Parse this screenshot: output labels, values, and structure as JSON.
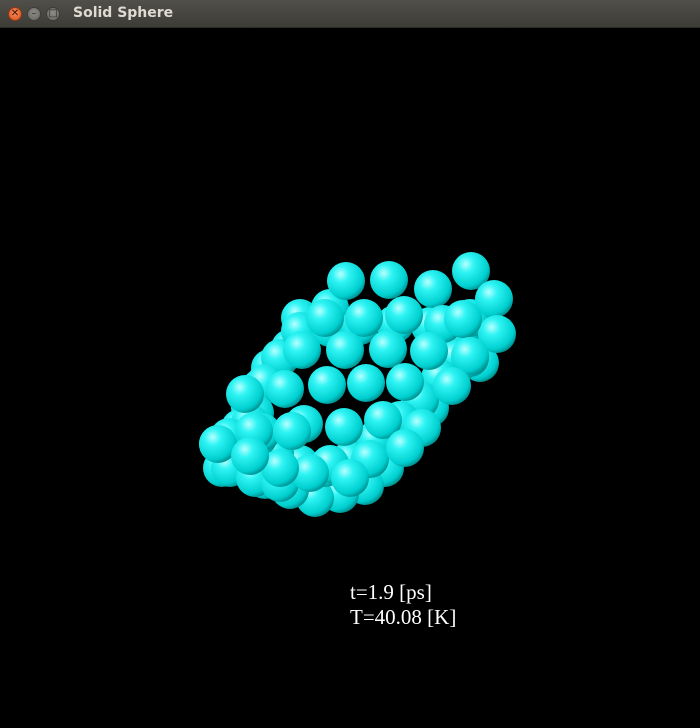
{
  "window": {
    "title": "Solid Sphere",
    "buttons": {
      "close_icon": "close-icon",
      "minimize_icon": "minimize-icon",
      "maximize_icon": "maximize-icon"
    }
  },
  "colors": {
    "background": "#000000",
    "sphere": "#00e8e8",
    "text": "#ffffff"
  },
  "readout": {
    "time": "t=1.9 [ps]",
    "temperature": "T=40.08 [K]"
  }
}
